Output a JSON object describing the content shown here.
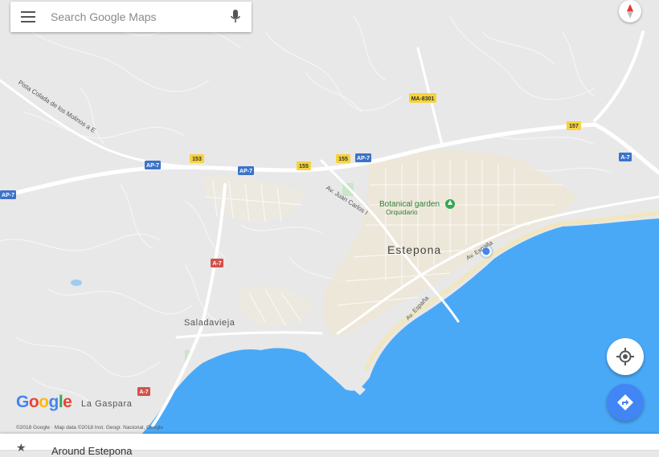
{
  "search": {
    "placeholder": "Search Google Maps",
    "menu_icon": "hamburger-menu-icon",
    "mic_icon": "microphone-icon"
  },
  "compass_icon": "compass-icon",
  "map": {
    "places": {
      "estepona": "Estepona",
      "saladavieja": "Saladavieja",
      "la_gaspara": "La Gaspara"
    },
    "poi": {
      "botanical_garden": "Botanical garden",
      "orquidario": "Orquidario"
    },
    "streets": {
      "pista_colada": "Pista Colada de los Molinos a E",
      "av_juan_carlos": "Av. Juan Carlos I",
      "av_espana_north": "Av. España",
      "av_espana_south": "Av. España"
    },
    "road_shields": {
      "ma8301": "MA-8301",
      "r157": "157",
      "ap7_left": "AP-7",
      "ap7_a": "AP-7",
      "r153": "153",
      "ap7_b": "AP-7",
      "r155_a": "155",
      "r155_b": "155",
      "ap7_c": "AP-7",
      "a7_right": "A-7",
      "a7_mid": "A-7",
      "a7_bottom": "A-7"
    }
  },
  "buttons": {
    "my_location_icon": "my-location-icon",
    "directions_icon": "directions-icon"
  },
  "logo": {
    "letters": [
      "G",
      "o",
      "o",
      "g",
      "l",
      "e"
    ]
  },
  "copyright": "©2018 Google · Map data ©2018 Inst. Geogr. Nacional, Google",
  "bottom_sheet": {
    "label": "Around Estepona"
  },
  "colors": {
    "water": "#4aa9f7",
    "land": "#e8e8e8",
    "road": "#ffffff",
    "urban": "#efe7d5",
    "user_dot": "#4285f4",
    "shield_yellow": "#f6d33c",
    "shield_blue": "#3b73c9",
    "shield_red": "#d2514b"
  }
}
